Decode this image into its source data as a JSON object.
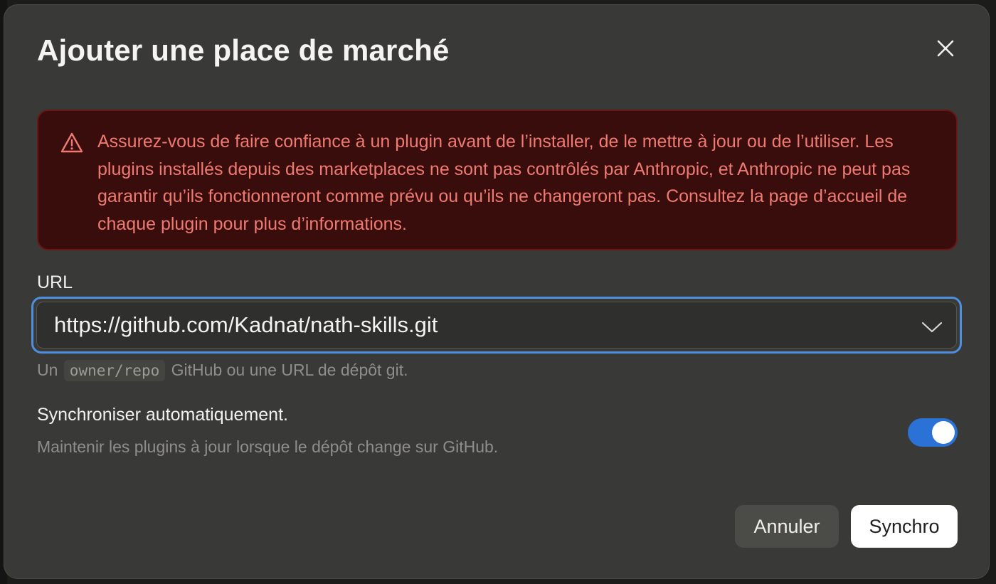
{
  "dialog": {
    "title": "Ajouter une place de marché",
    "close_icon": "close-icon"
  },
  "warning": {
    "icon": "warning-triangle-icon",
    "text": "Assurez-vous de faire confiance à un plugin avant de l’installer, de le mettre à jour ou de l’utiliser. Les plugins installés depuis des marketplaces ne sont pas contrôlés par Anthropic, et Anthropic ne peut pas garantir qu’ils fonctionneront comme prévu ou qu’ils ne changeront pas. Consultez la page d’accueil de chaque plugin pour plus d’informations.",
    "color": "#ef7a72"
  },
  "url_field": {
    "label": "URL",
    "value": "https://github.com/Kadnat/nath-skills.git",
    "dropdown_icon": "chevron-down-icon",
    "hint_prefix": "Un",
    "hint_code": "owner/repo",
    "hint_suffix": "GitHub ou une URL de dépôt git.",
    "focus_color": "#4f8fdd"
  },
  "auto_sync": {
    "title": "Synchroniser automatiquement.",
    "description": "Maintenir les plugins à jour lorsque le dépôt change sur GitHub.",
    "enabled": true,
    "toggle_color": "#2b72d6"
  },
  "actions": {
    "cancel_label": "Annuler",
    "sync_label": "Synchro"
  }
}
